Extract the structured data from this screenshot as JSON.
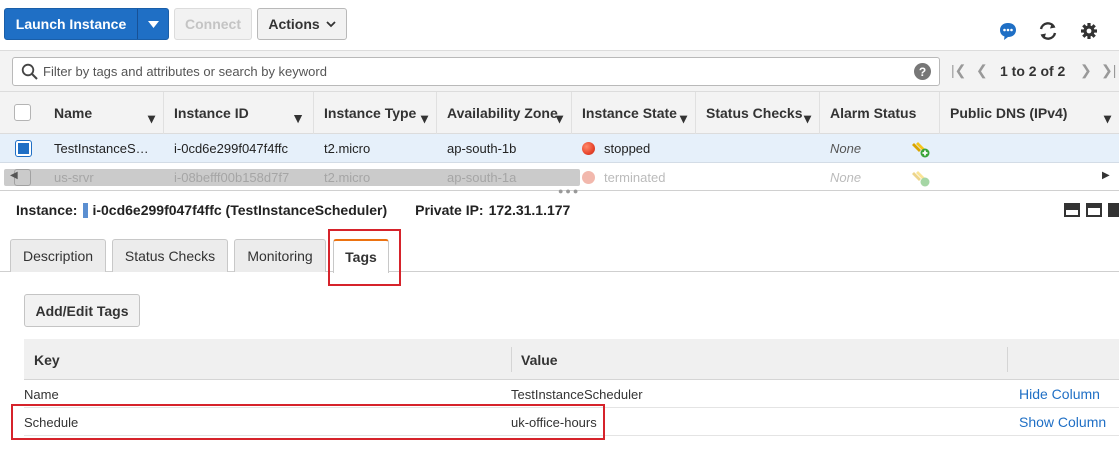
{
  "toolbar": {
    "launch_label": "Launch Instance",
    "connect_label": "Connect",
    "actions_label": "Actions",
    "icons": [
      "chat-icon",
      "refresh-icon",
      "gear-icon"
    ]
  },
  "filter": {
    "placeholder": "Filter by tags and attributes or search by keyword",
    "pager_text": "1 to 2 of 2"
  },
  "instances": {
    "columns": [
      "Name",
      "Instance ID",
      "Instance Type",
      "Availability Zone",
      "Instance State",
      "Status Checks",
      "Alarm Status",
      "Public DNS (IPv4)"
    ],
    "rows": [
      {
        "name": "TestInstanceS…",
        "id": "i-0cd6e299f047f4ffc",
        "type": "t2.micro",
        "zone": "ap-south-1b",
        "state": "stopped",
        "state_color": "#e8452c",
        "alarm": "None",
        "selected": true
      },
      {
        "name": "us-srvr",
        "id": "i-08befff00b158d7f7",
        "type": "t2.micro",
        "zone": "ap-south-1a",
        "state": "terminated",
        "state_color": "#f2b8ad",
        "alarm": "None",
        "selected": false
      }
    ]
  },
  "detail": {
    "instance_label": "Instance:",
    "instance_value": "i-0cd6e299f047f4ffc (TestInstanceScheduler)",
    "private_ip_label": "Private IP:",
    "private_ip_value": "172.31.1.177"
  },
  "tabs": [
    {
      "label": "Description"
    },
    {
      "label": "Status Checks"
    },
    {
      "label": "Monitoring"
    },
    {
      "label": "Tags",
      "active": true
    }
  ],
  "tags": {
    "add_edit_label": "Add/Edit Tags",
    "key_header": "Key",
    "value_header": "Value",
    "rows": [
      {
        "key": "Name",
        "value": "TestInstanceScheduler",
        "action": "Hide Column"
      },
      {
        "key": "Schedule",
        "value": "uk-office-hours",
        "action": "Show Column"
      }
    ]
  },
  "colors": {
    "primary": "#1f6fc5",
    "highlight": "#d6232b",
    "active_tab_accent": "#ec7211"
  }
}
